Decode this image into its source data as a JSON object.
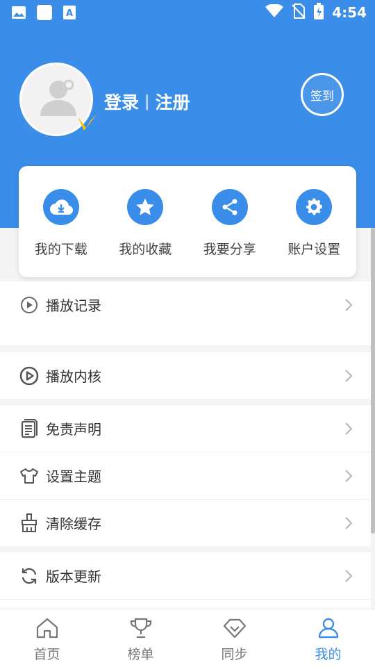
{
  "status_bar": {
    "time": "4:54",
    "icons": [
      "image-icon",
      "square-icon",
      "text-a-icon",
      "wifi-icon",
      "no-sim-icon",
      "battery-charging-icon"
    ]
  },
  "profile": {
    "login_label": "登录",
    "separator": "|",
    "register_label": "注册",
    "signin_label": "签到",
    "avatar_icon": "user-avatar-icon",
    "badge_icon": "v-badge-icon"
  },
  "quick_actions": [
    {
      "label": "我的下载",
      "icon": "cloud-download-icon"
    },
    {
      "label": "我的收藏",
      "icon": "star-icon"
    },
    {
      "label": "我要分享",
      "icon": "share-icon"
    },
    {
      "label": "账户设置",
      "icon": "gear-icon"
    }
  ],
  "menu": [
    {
      "label": "播放记录",
      "icon": "play-circle-icon"
    },
    {
      "label": "播放内核",
      "icon": "play-circle-bold-icon"
    },
    {
      "label": "免责声明",
      "icon": "document-icon"
    },
    {
      "label": "设置主题",
      "icon": "tshirt-icon"
    },
    {
      "label": "清除缓存",
      "icon": "broom-icon"
    },
    {
      "label": "版本更新",
      "icon": "refresh-icon"
    }
  ],
  "bottom_nav": [
    {
      "label": "首页",
      "icon": "home-icon",
      "active": false
    },
    {
      "label": "榜单",
      "icon": "trophy-icon",
      "active": false
    },
    {
      "label": "同步",
      "icon": "diamond-icon",
      "active": false
    },
    {
      "label": "我的",
      "icon": "person-icon",
      "active": true
    }
  ],
  "colors": {
    "primary": "#3a8de8",
    "badge": "#f5c400",
    "background": "#f4f4f4"
  }
}
